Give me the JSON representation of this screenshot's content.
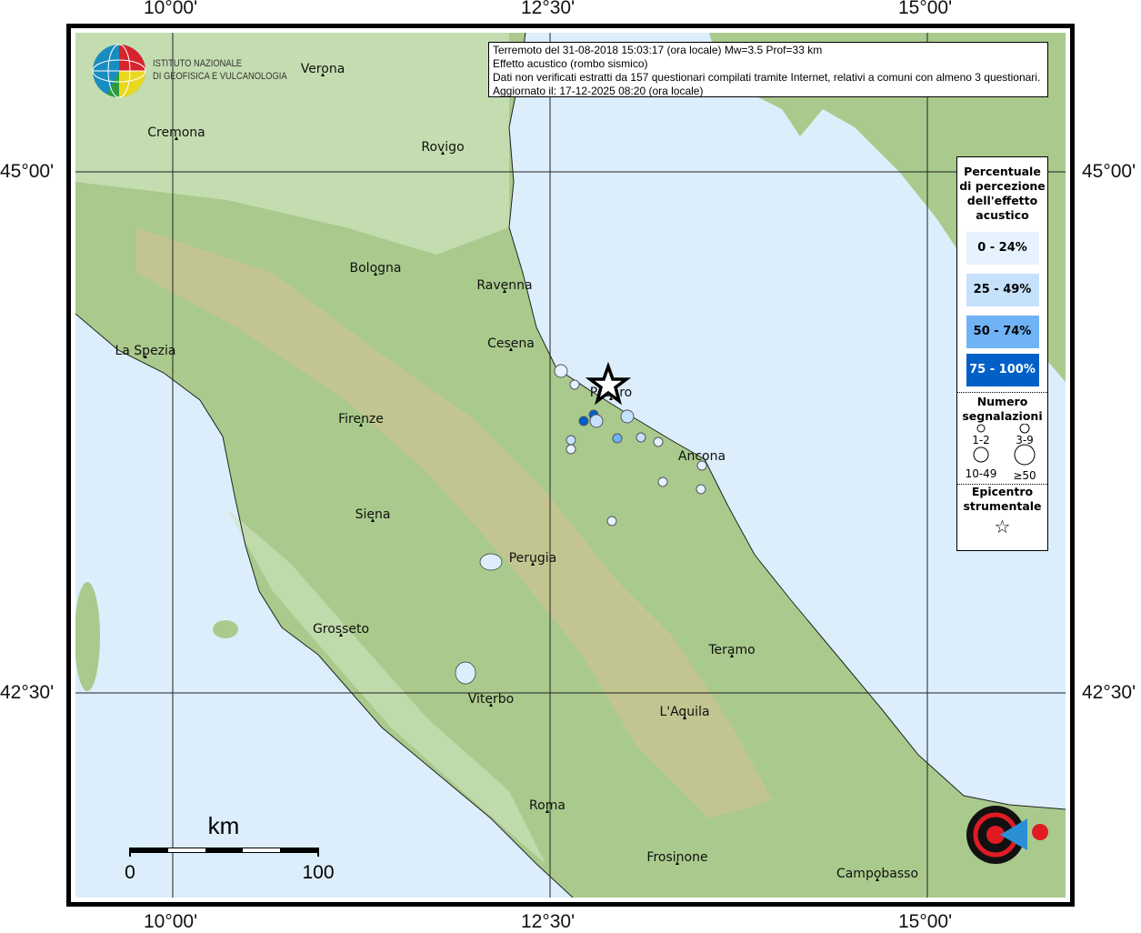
{
  "info": {
    "line1": "Terremoto del 31-08-2018 15:03:17 (ora locale) Mw=3.5 Prof=33 km",
    "line2": "Effetto acustico (rombo sismico)",
    "line3": "Dati non verificati estratti da 157 questionari compilati tramite Internet, relativi a comuni con almeno 3 questionari.",
    "line4": "Aggiornato il: 17-12-2025 08:20 (ora locale)"
  },
  "logo_ingv": {
    "line1": "ISTITUTO NAZIONALE",
    "line2": "DI GEOFISICA E VULCANOLOGIA"
  },
  "logo_hsit": "www.haisentitoilterremoto.it",
  "axes": {
    "lon": [
      "10°00'",
      "12°30'",
      "15°00'"
    ],
    "lat": [
      "45°00'",
      "42°30'"
    ]
  },
  "legend": {
    "title": "Percentuale di percezione dell'effetto acustico",
    "classes": [
      {
        "label": "0 - 24%",
        "color": "#e6f3fe"
      },
      {
        "label": "25 - 49%",
        "color": "#c6e1fb"
      },
      {
        "label": "50 - 74%",
        "color": "#6fb3f5"
      },
      {
        "label": "75 - 100%",
        "color": "#0060c8"
      }
    ],
    "count_title": "Numero segnalazioni",
    "counts": [
      "1-2",
      "3-9",
      "10-49",
      "≥50"
    ],
    "epicenter_title": "Epicentro strumentale"
  },
  "cities": [
    "Verona",
    "Cremona",
    "Rovigo",
    "Bologna",
    "Ravenna",
    "Cesena",
    "La Spezia",
    "Pesaro",
    "Firenze",
    "Ancona",
    "Siena",
    "Perugia",
    "Grosseto",
    "Teramo",
    "Viterbo",
    "L'Aquila",
    "Roma",
    "Frosinone",
    "Campobasso"
  ],
  "scale": {
    "unit": "km",
    "min": "0",
    "max": "100"
  },
  "colors": {
    "sea": "#dceefb",
    "land": "#a9ca8c"
  }
}
